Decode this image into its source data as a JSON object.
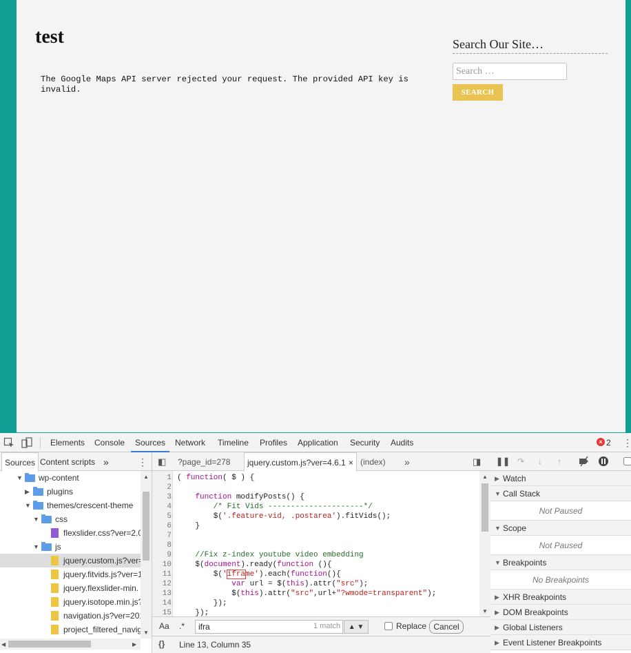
{
  "page": {
    "title": "test",
    "map_error": "The Google Maps API server rejected your request. The provided API key is invalid.",
    "search_heading": "Search Our Site…",
    "search_placeholder": "Search …",
    "search_button": "SEARCH"
  },
  "devtools": {
    "tabs": [
      "Elements",
      "Console",
      "Sources",
      "Network",
      "Timeline",
      "Profiles",
      "Application",
      "Security",
      "Audits"
    ],
    "active_tab": "Sources",
    "error_count": "2",
    "navigator_tabs": [
      "Sources",
      "Content scripts"
    ],
    "more_glyph": "»",
    "tree": [
      {
        "label": "wp-content",
        "kind": "folder",
        "expanded": true
      },
      {
        "label": "plugins",
        "kind": "folder",
        "expanded": false
      },
      {
        "label": "themes/crescent-theme",
        "kind": "folder",
        "expanded": true
      },
      {
        "label": "css",
        "kind": "folder",
        "expanded": true
      },
      {
        "label": "flexslider.css?ver=2.0",
        "kind": "css"
      },
      {
        "label": "js",
        "kind": "folder",
        "expanded": true
      },
      {
        "label": "jquery.custom.js?ver=",
        "kind": "js",
        "selected": true
      },
      {
        "label": "jquery.fitvids.js?ver=1",
        "kind": "js"
      },
      {
        "label": "jquery.flexslider-min.",
        "kind": "js"
      },
      {
        "label": "jquery.isotope.min.js?",
        "kind": "js"
      },
      {
        "label": "navigation.js?ver=201",
        "kind": "js"
      },
      {
        "label": "project_filtered_navig",
        "kind": "js"
      }
    ],
    "editor_tabs": [
      "?page_id=278",
      "jquery.custom.js?ver=4.6.1",
      "(index)"
    ],
    "active_editor_tab": "jquery.custom.js?ver=4.6.1",
    "code_lines": [
      "( function( $ ) {",
      "",
      "    function modifyPosts() {",
      "        /* Fit Vids ---------------------*/",
      "        $('.feature-vid, .postarea').fitVids();",
      "    }",
      "",
      "",
      "    //Fix z-index youtube video embedding",
      "    $(document).ready(function (){",
      "        $('iframe').each(function(){",
      "            var url = $(this).attr(\"src\");",
      "            $(this).attr(\"src\",url+\"?wmode=transparent\");",
      "        });",
      "    });"
    ],
    "line_numbers": [
      "1",
      "2",
      "3",
      "4",
      "5",
      "6",
      "7",
      "8",
      "9",
      "10",
      "11",
      "12",
      "13",
      "14",
      "15"
    ],
    "search": {
      "case_label": "Aa",
      "regex_label": ".*",
      "query": "ifra",
      "match_count": "1 match",
      "replace_label": "Replace",
      "cancel_label": "Cancel"
    },
    "status": {
      "braces": "{}",
      "cursor": "Line 13, Column 35"
    },
    "debugger_panes": {
      "watch": "Watch",
      "call_stack": "Call Stack",
      "call_stack_body": "Not Paused",
      "scope": "Scope",
      "scope_body": "Not Paused",
      "breakpoints": "Breakpoints",
      "breakpoints_body": "No Breakpoints",
      "xhr": "XHR Breakpoints",
      "dom": "DOM Breakpoints",
      "global": "Global Listeners",
      "event": "Event Listener Breakpoints"
    }
  }
}
